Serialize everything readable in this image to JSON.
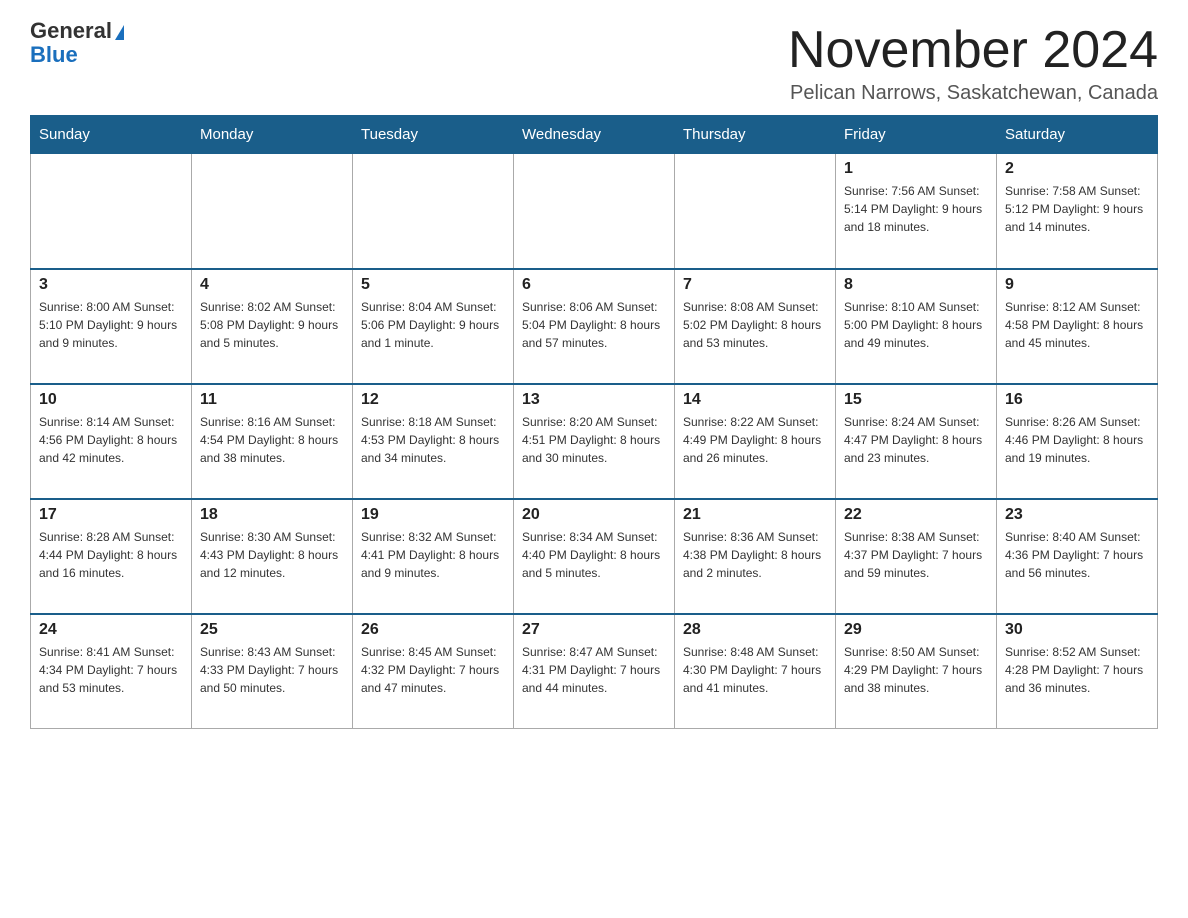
{
  "logo": {
    "text1": "General",
    "text2": "Blue"
  },
  "title": "November 2024",
  "location": "Pelican Narrows, Saskatchewan, Canada",
  "weekdays": [
    "Sunday",
    "Monday",
    "Tuesday",
    "Wednesday",
    "Thursday",
    "Friday",
    "Saturday"
  ],
  "weeks": [
    [
      {
        "day": "",
        "info": ""
      },
      {
        "day": "",
        "info": ""
      },
      {
        "day": "",
        "info": ""
      },
      {
        "day": "",
        "info": ""
      },
      {
        "day": "",
        "info": ""
      },
      {
        "day": "1",
        "info": "Sunrise: 7:56 AM\nSunset: 5:14 PM\nDaylight: 9 hours\nand 18 minutes."
      },
      {
        "day": "2",
        "info": "Sunrise: 7:58 AM\nSunset: 5:12 PM\nDaylight: 9 hours\nand 14 minutes."
      }
    ],
    [
      {
        "day": "3",
        "info": "Sunrise: 8:00 AM\nSunset: 5:10 PM\nDaylight: 9 hours\nand 9 minutes."
      },
      {
        "day": "4",
        "info": "Sunrise: 8:02 AM\nSunset: 5:08 PM\nDaylight: 9 hours\nand 5 minutes."
      },
      {
        "day": "5",
        "info": "Sunrise: 8:04 AM\nSunset: 5:06 PM\nDaylight: 9 hours\nand 1 minute."
      },
      {
        "day": "6",
        "info": "Sunrise: 8:06 AM\nSunset: 5:04 PM\nDaylight: 8 hours\nand 57 minutes."
      },
      {
        "day": "7",
        "info": "Sunrise: 8:08 AM\nSunset: 5:02 PM\nDaylight: 8 hours\nand 53 minutes."
      },
      {
        "day": "8",
        "info": "Sunrise: 8:10 AM\nSunset: 5:00 PM\nDaylight: 8 hours\nand 49 minutes."
      },
      {
        "day": "9",
        "info": "Sunrise: 8:12 AM\nSunset: 4:58 PM\nDaylight: 8 hours\nand 45 minutes."
      }
    ],
    [
      {
        "day": "10",
        "info": "Sunrise: 8:14 AM\nSunset: 4:56 PM\nDaylight: 8 hours\nand 42 minutes."
      },
      {
        "day": "11",
        "info": "Sunrise: 8:16 AM\nSunset: 4:54 PM\nDaylight: 8 hours\nand 38 minutes."
      },
      {
        "day": "12",
        "info": "Sunrise: 8:18 AM\nSunset: 4:53 PM\nDaylight: 8 hours\nand 34 minutes."
      },
      {
        "day": "13",
        "info": "Sunrise: 8:20 AM\nSunset: 4:51 PM\nDaylight: 8 hours\nand 30 minutes."
      },
      {
        "day": "14",
        "info": "Sunrise: 8:22 AM\nSunset: 4:49 PM\nDaylight: 8 hours\nand 26 minutes."
      },
      {
        "day": "15",
        "info": "Sunrise: 8:24 AM\nSunset: 4:47 PM\nDaylight: 8 hours\nand 23 minutes."
      },
      {
        "day": "16",
        "info": "Sunrise: 8:26 AM\nSunset: 4:46 PM\nDaylight: 8 hours\nand 19 minutes."
      }
    ],
    [
      {
        "day": "17",
        "info": "Sunrise: 8:28 AM\nSunset: 4:44 PM\nDaylight: 8 hours\nand 16 minutes."
      },
      {
        "day": "18",
        "info": "Sunrise: 8:30 AM\nSunset: 4:43 PM\nDaylight: 8 hours\nand 12 minutes."
      },
      {
        "day": "19",
        "info": "Sunrise: 8:32 AM\nSunset: 4:41 PM\nDaylight: 8 hours\nand 9 minutes."
      },
      {
        "day": "20",
        "info": "Sunrise: 8:34 AM\nSunset: 4:40 PM\nDaylight: 8 hours\nand 5 minutes."
      },
      {
        "day": "21",
        "info": "Sunrise: 8:36 AM\nSunset: 4:38 PM\nDaylight: 8 hours\nand 2 minutes."
      },
      {
        "day": "22",
        "info": "Sunrise: 8:38 AM\nSunset: 4:37 PM\nDaylight: 7 hours\nand 59 minutes."
      },
      {
        "day": "23",
        "info": "Sunrise: 8:40 AM\nSunset: 4:36 PM\nDaylight: 7 hours\nand 56 minutes."
      }
    ],
    [
      {
        "day": "24",
        "info": "Sunrise: 8:41 AM\nSunset: 4:34 PM\nDaylight: 7 hours\nand 53 minutes."
      },
      {
        "day": "25",
        "info": "Sunrise: 8:43 AM\nSunset: 4:33 PM\nDaylight: 7 hours\nand 50 minutes."
      },
      {
        "day": "26",
        "info": "Sunrise: 8:45 AM\nSunset: 4:32 PM\nDaylight: 7 hours\nand 47 minutes."
      },
      {
        "day": "27",
        "info": "Sunrise: 8:47 AM\nSunset: 4:31 PM\nDaylight: 7 hours\nand 44 minutes."
      },
      {
        "day": "28",
        "info": "Sunrise: 8:48 AM\nSunset: 4:30 PM\nDaylight: 7 hours\nand 41 minutes."
      },
      {
        "day": "29",
        "info": "Sunrise: 8:50 AM\nSunset: 4:29 PM\nDaylight: 7 hours\nand 38 minutes."
      },
      {
        "day": "30",
        "info": "Sunrise: 8:52 AM\nSunset: 4:28 PM\nDaylight: 7 hours\nand 36 minutes."
      }
    ]
  ]
}
